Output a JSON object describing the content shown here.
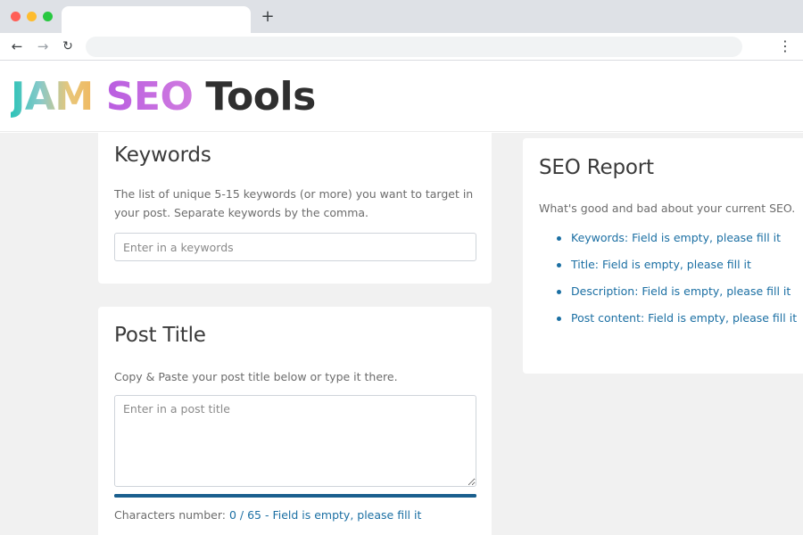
{
  "browser": {
    "new_tab_icon": "plus-icon",
    "address": "",
    "nav": {
      "back_icon": "arrow-left-icon",
      "forward_icon": "arrow-right-icon",
      "reload_icon": "reload-icon",
      "menu_icon": "kebab-menu-icon"
    }
  },
  "logo": {
    "jam": "JAM",
    "seo": "SEO",
    "tools": "Tools"
  },
  "keywords_card": {
    "heading": "Keywords",
    "description": "The list of unique 5-15 keywords (or more) you want to target in your post. Separate keywords by the comma.",
    "input_placeholder": "Enter in a keywords",
    "input_value": ""
  },
  "post_title_card": {
    "heading": "Post Title",
    "description": "Copy & Paste your post title below or type it there.",
    "textarea_placeholder": "Enter in a post title",
    "textarea_value": "",
    "char_label": "Characters number:",
    "char_status": "0 / 65 - Field is empty, please fill it",
    "progress_percent": 100
  },
  "seo_report": {
    "heading": "SEO Report",
    "description": "What's good and bad about your current SEO.",
    "items": [
      "Keywords: Field is empty, please fill it",
      "Title: Field is empty, please fill it",
      "Description: Field is empty, please fill it",
      "Post content: Field is empty, please fill it"
    ]
  },
  "colors": {
    "link": "#1b6fa3",
    "progress": "#1a5f8e",
    "page_bg": "#f1f1f1"
  }
}
